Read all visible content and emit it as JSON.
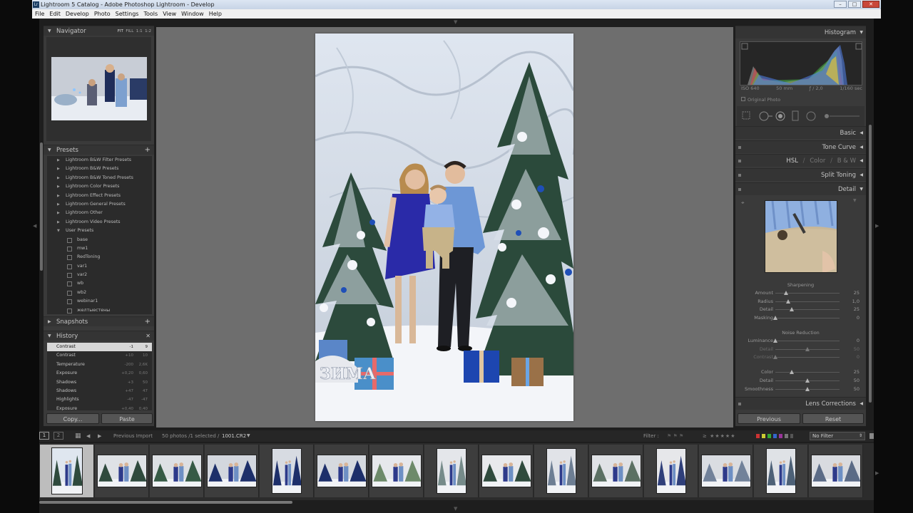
{
  "window": {
    "title": "Lightroom 5 Catalog - Adobe Photoshop Lightroom - Develop",
    "app_icon": "Lr",
    "minimize": "–",
    "maximize": "□",
    "close": "✕"
  },
  "menu": [
    "File",
    "Edit",
    "Develop",
    "Photo",
    "Settings",
    "Tools",
    "View",
    "Window",
    "Help"
  ],
  "navigator": {
    "title": "Navigator",
    "zoom": [
      "FIT",
      "FILL",
      "1:1",
      "1:2"
    ]
  },
  "presets": {
    "title": "Presets",
    "add": "+",
    "items": [
      {
        "label": "Lightroom B&W Filter Presets",
        "type": "grp"
      },
      {
        "label": "Lightroom B&W Presets",
        "type": "grp"
      },
      {
        "label": "Lightroom B&W Toned Presets",
        "type": "grp"
      },
      {
        "label": "Lightroom Color Presets",
        "type": "grp"
      },
      {
        "label": "Lightroom Effect Presets",
        "type": "grp"
      },
      {
        "label": "Lightroom General Presets",
        "type": "grp"
      },
      {
        "label": "Lightroom Other",
        "type": "grp"
      },
      {
        "label": "Lightroom Video Presets",
        "type": "grp"
      },
      {
        "label": "User Presets",
        "type": "open"
      },
      {
        "label": "base",
        "type": "child"
      },
      {
        "label": "mw1",
        "type": "child"
      },
      {
        "label": "RedToning",
        "type": "child"
      },
      {
        "label": "var1",
        "type": "child"
      },
      {
        "label": "var2",
        "type": "child"
      },
      {
        "label": "wb",
        "type": "child"
      },
      {
        "label": "wb2",
        "type": "child"
      },
      {
        "label": "webinar1",
        "type": "child"
      },
      {
        "label": "желтыестены",
        "type": "child"
      }
    ]
  },
  "snapshots": {
    "title": "Snapshots",
    "add": "+"
  },
  "history": {
    "title": "History",
    "clear": "✕",
    "items": [
      {
        "label": "Contrast",
        "v1": "-1",
        "v2": "9",
        "sel": true
      },
      {
        "label": "Contrast",
        "v1": "+10",
        "v2": "10"
      },
      {
        "label": "Temperature",
        "v1": "-200",
        "v2": "2,6K"
      },
      {
        "label": "Exposure",
        "v1": "+0,20",
        "v2": "0,60"
      },
      {
        "label": "Shadows",
        "v1": "+3",
        "v2": "50"
      },
      {
        "label": "Shadows",
        "v1": "+47",
        "v2": "47"
      },
      {
        "label": "Highlights",
        "v1": "-47",
        "v2": "-47"
      },
      {
        "label": "Exposure",
        "v1": "+0,40",
        "v2": "0,40"
      }
    ]
  },
  "left_buttons": {
    "copy": "Copy...",
    "paste": "Paste"
  },
  "histogram": {
    "title": "Histogram",
    "iso": "ISO 640",
    "focal": "50 mm",
    "aperture": "ƒ / 2,0",
    "shutter": "1/160 sec",
    "original": "Original Photo"
  },
  "sections": {
    "basic": "Basic",
    "tone_curve": "Tone Curve",
    "hsl": "HSL",
    "sep1": "/",
    "color": "Color",
    "sep2": "/",
    "bw": "B & W",
    "split_toning": "Split Toning",
    "detail": "Detail",
    "lens_corrections": "Lens Corrections"
  },
  "sharpening": {
    "title": "Sharpening",
    "rows": [
      {
        "label": "Amount",
        "value": "25",
        "pos": 0.17,
        "dim": false
      },
      {
        "label": "Radius",
        "value": "1,0",
        "pos": 0.2,
        "dim": false
      },
      {
        "label": "Detail",
        "value": "25",
        "pos": 0.25,
        "dim": false
      },
      {
        "label": "Masking",
        "value": "0",
        "pos": 0.0,
        "dim": false
      }
    ]
  },
  "noise": {
    "title": "Noise Reduction",
    "rows": [
      {
        "label": "Luminance",
        "value": "0",
        "pos": 0.0,
        "dim": false
      },
      {
        "label": "Detail",
        "value": "50",
        "pos": 0.5,
        "dim": true
      },
      {
        "label": "Contrast",
        "value": "0",
        "pos": 0.0,
        "dim": true
      },
      {
        "label": "Color",
        "value": "25",
        "pos": 0.25,
        "dim": false
      },
      {
        "label": "Detail",
        "value": "50",
        "pos": 0.5,
        "dim": false
      },
      {
        "label": "Smoothness",
        "value": "50",
        "pos": 0.5,
        "dim": false
      }
    ]
  },
  "right_buttons": {
    "previous": "Previous",
    "reset": "Reset"
  },
  "filmbar": {
    "view1": "1",
    "view2": "2",
    "source": "Previous Import",
    "count": "50 photos /1 selected /",
    "file": "1001.CR2",
    "filter_label": "Filter :",
    "filter_value": "No Filter"
  }
}
